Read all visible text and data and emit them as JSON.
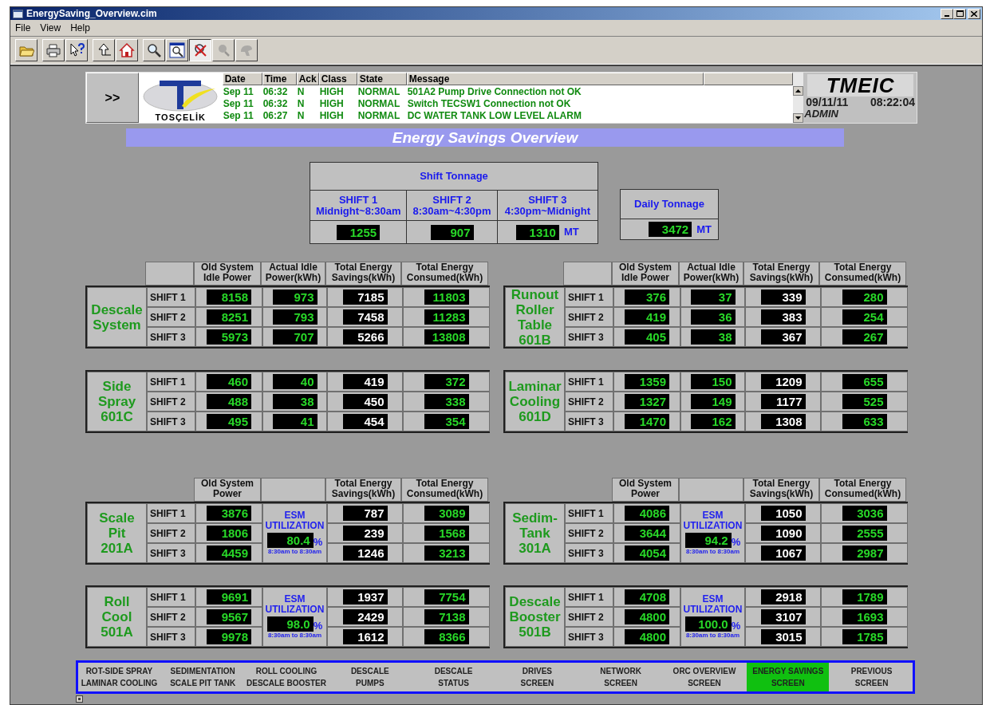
{
  "window": {
    "title": "EnergySaving_Overview.cim"
  },
  "menu": [
    "File",
    "View",
    "Help"
  ],
  "toolbar": [
    [
      {
        "kind": "open",
        "pressed": false,
        "disabled": false
      }
    ],
    [
      {
        "kind": "print",
        "pressed": false,
        "disabled": false
      },
      {
        "kind": "help",
        "pressed": false,
        "disabled": false
      }
    ],
    [
      {
        "kind": "up",
        "pressed": false,
        "disabled": false
      },
      {
        "kind": "home",
        "pressed": false,
        "disabled": false
      }
    ],
    [
      {
        "kind": "zoom",
        "pressed": false,
        "disabled": false
      },
      {
        "kind": "zoom_box",
        "pressed": false,
        "disabled": false
      },
      {
        "kind": "zoom_reset",
        "pressed": true,
        "disabled": false
      },
      {
        "kind": "zoom_back",
        "pressed": false,
        "disabled": true
      },
      {
        "kind": "pan",
        "pressed": false,
        "disabled": true
      }
    ]
  ],
  "alarm_panel": {
    "expand_button": ">>",
    "logo_text": "TOSÇELİK",
    "columns": [
      "Date",
      "Time",
      "Ack",
      "Class",
      "State",
      "Message"
    ],
    "rows": [
      {
        "date": "Sep 11",
        "time": "06:32",
        "ack": "N",
        "class": "HIGH",
        "state": "NORMAL",
        "message": "501A2 Pump Drive Connection  not OK"
      },
      {
        "date": "Sep 11",
        "time": "06:32",
        "ack": "N",
        "class": "HIGH",
        "state": "NORMAL",
        "message": "Switch TECSW1 Connection not OK"
      },
      {
        "date": "Sep 11",
        "time": "06:27",
        "ack": "N",
        "class": "HIGH",
        "state": "NORMAL",
        "message": "DC WATER TANK LOW LEVEL ALARM"
      }
    ]
  },
  "status_box": {
    "logo": "TMEIC",
    "date": "09/11/11",
    "time": "08:22:04",
    "user": "ADMIN"
  },
  "banner": "Energy Savings Overview",
  "shift_tonnage": {
    "title": "Shift Tonnage",
    "unit": "MT",
    "shifts": [
      {
        "name": "SHIFT 1",
        "hours": "Midnight~8:30am",
        "value": "1255"
      },
      {
        "name": "SHIFT 2",
        "hours": "8:30am~4:30pm",
        "value": "907"
      },
      {
        "name": "SHIFT 3",
        "hours": "4:30pm~Midnight",
        "value": "1310"
      }
    ]
  },
  "daily_tonnage": {
    "title": "Daily Tonnage",
    "value": "3472",
    "unit": "MT"
  },
  "panel_rows": [
    [
      {
        "kind": "idle",
        "name": "Descale\nSystem",
        "columns": [
          "Old System\nIdle Power",
          "Actual Idle\nPower(kWh)",
          "Total Energy\nSavings(kWh)",
          "Total Energy\nConsumed(kWh)"
        ],
        "shifts": [
          {
            "label": "SHIFT 1",
            "values": [
              "8158",
              "973",
              "7185",
              "11803"
            ]
          },
          {
            "label": "SHIFT 2",
            "values": [
              "8251",
              "793",
              "7458",
              "11283"
            ]
          },
          {
            "label": "SHIFT 3",
            "values": [
              "5973",
              "707",
              "5266",
              "13808"
            ]
          }
        ]
      },
      {
        "kind": "idle",
        "name": "Runout\nRoller\nTable\n601B",
        "columns": [
          "Old System\nIdle Power",
          "Actual Idle\nPower(kWh)",
          "Total Energy\nSavings(kWh)",
          "Total Energy\nConsumed(kWh)"
        ],
        "shifts": [
          {
            "label": "SHIFT 1",
            "values": [
              "376",
              "37",
              "339",
              "280"
            ]
          },
          {
            "label": "SHIFT 2",
            "values": [
              "419",
              "36",
              "383",
              "254"
            ]
          },
          {
            "label": "SHIFT 3",
            "values": [
              "405",
              "38",
              "367",
              "267"
            ]
          }
        ]
      }
    ],
    [
      {
        "kind": "idle",
        "name": "Side\nSpray\n601C",
        "shifts": [
          {
            "label": "SHIFT 1",
            "values": [
              "460",
              "40",
              "419",
              "372"
            ]
          },
          {
            "label": "SHIFT 2",
            "values": [
              "488",
              "38",
              "450",
              "338"
            ]
          },
          {
            "label": "SHIFT 3",
            "values": [
              "495",
              "41",
              "454",
              "354"
            ]
          }
        ]
      },
      {
        "kind": "idle",
        "name": "Laminar\nCooling\n601D",
        "shifts": [
          {
            "label": "SHIFT 1",
            "values": [
              "1359",
              "150",
              "1209",
              "655"
            ]
          },
          {
            "label": "SHIFT 2",
            "values": [
              "1327",
              "149",
              "1177",
              "525"
            ]
          },
          {
            "label": "SHIFT 3",
            "values": [
              "1470",
              "162",
              "1308",
              "633"
            ]
          }
        ]
      }
    ],
    [
      {
        "kind": "esm",
        "name": "Scale\nPit\n201A",
        "columns": [
          "Old System\nPower",
          "Total Energy\nSavings(kWh)",
          "Total Energy\nConsumed(kWh)"
        ],
        "esm": {
          "title": "ESM\nUTILIZATION",
          "value": "80.4",
          "unit": "%",
          "period": "8:30am to 8:30am"
        },
        "shifts": [
          {
            "label": "SHIFT 1",
            "values": [
              "3876",
              "787",
              "3089"
            ]
          },
          {
            "label": "SHIFT 2",
            "values": [
              "1806",
              "239",
              "1568"
            ]
          },
          {
            "label": "SHIFT 3",
            "values": [
              "4459",
              "1246",
              "3213"
            ]
          }
        ]
      },
      {
        "kind": "esm",
        "name": "Sedim-\nTank\n301A",
        "columns": [
          "Old System\nPower",
          "Total Energy\nSavings(kWh)",
          "Total Energy\nConsumed(kWh)"
        ],
        "esm": {
          "title": "ESM\nUTILIZATION",
          "value": "94.2",
          "unit": "%",
          "period": "8:30am to 8:30am"
        },
        "shifts": [
          {
            "label": "SHIFT 1",
            "values": [
              "4086",
              "1050",
              "3036"
            ]
          },
          {
            "label": "SHIFT 2",
            "values": [
              "3644",
              "1090",
              "2555"
            ]
          },
          {
            "label": "SHIFT 3",
            "values": [
              "4054",
              "1067",
              "2987"
            ]
          }
        ]
      }
    ],
    [
      {
        "kind": "esm",
        "name": "Roll\nCool\n501A",
        "esm": {
          "title": "ESM\nUTILIZATION",
          "value": "98.0",
          "unit": "%",
          "period": "8:30am to 8:30am"
        },
        "shifts": [
          {
            "label": "SHIFT 1",
            "values": [
              "9691",
              "1937",
              "7754"
            ]
          },
          {
            "label": "SHIFT 2",
            "values": [
              "9567",
              "2429",
              "7138"
            ]
          },
          {
            "label": "SHIFT 3",
            "values": [
              "9978",
              "1612",
              "8366"
            ]
          }
        ]
      },
      {
        "kind": "esm",
        "name": "Descale\nBooster\n501B",
        "esm": {
          "title": "ESM\nUTILIZATION",
          "value": "100.0",
          "unit": "%",
          "period": "8:30am to 8:30am"
        },
        "shifts": [
          {
            "label": "SHIFT 1",
            "values": [
              "4708",
              "2918",
              "1789"
            ]
          },
          {
            "label": "SHIFT 2",
            "values": [
              "4800",
              "3107",
              "1693"
            ]
          },
          {
            "label": "SHIFT 3",
            "values": [
              "4800",
              "3015",
              "1785"
            ]
          }
        ]
      }
    ]
  ],
  "nav": [
    {
      "label": "ROT-SIDE SPRAY\nLAMINAR COOLING",
      "selected": false
    },
    {
      "label": "SEDIMENTATION\nSCALE PIT TANK",
      "selected": false
    },
    {
      "label": "ROLL COOLING\nDESCALE BOOSTER",
      "selected": false
    },
    {
      "label": "DESCALE\nPUMPS",
      "selected": false
    },
    {
      "label": "DESCALE\nSTATUS",
      "selected": false
    },
    {
      "label": "DRIVES\nSCREEN",
      "selected": false
    },
    {
      "label": "NETWORK\nSCREEN",
      "selected": false
    },
    {
      "label": "ORC OVERVIEW\nSCREEN",
      "selected": false
    },
    {
      "label": "ENERGY SAVINGS\nSCREEN",
      "selected": true
    },
    {
      "label": "PREVIOUS\nSCREEN",
      "selected": false
    }
  ]
}
